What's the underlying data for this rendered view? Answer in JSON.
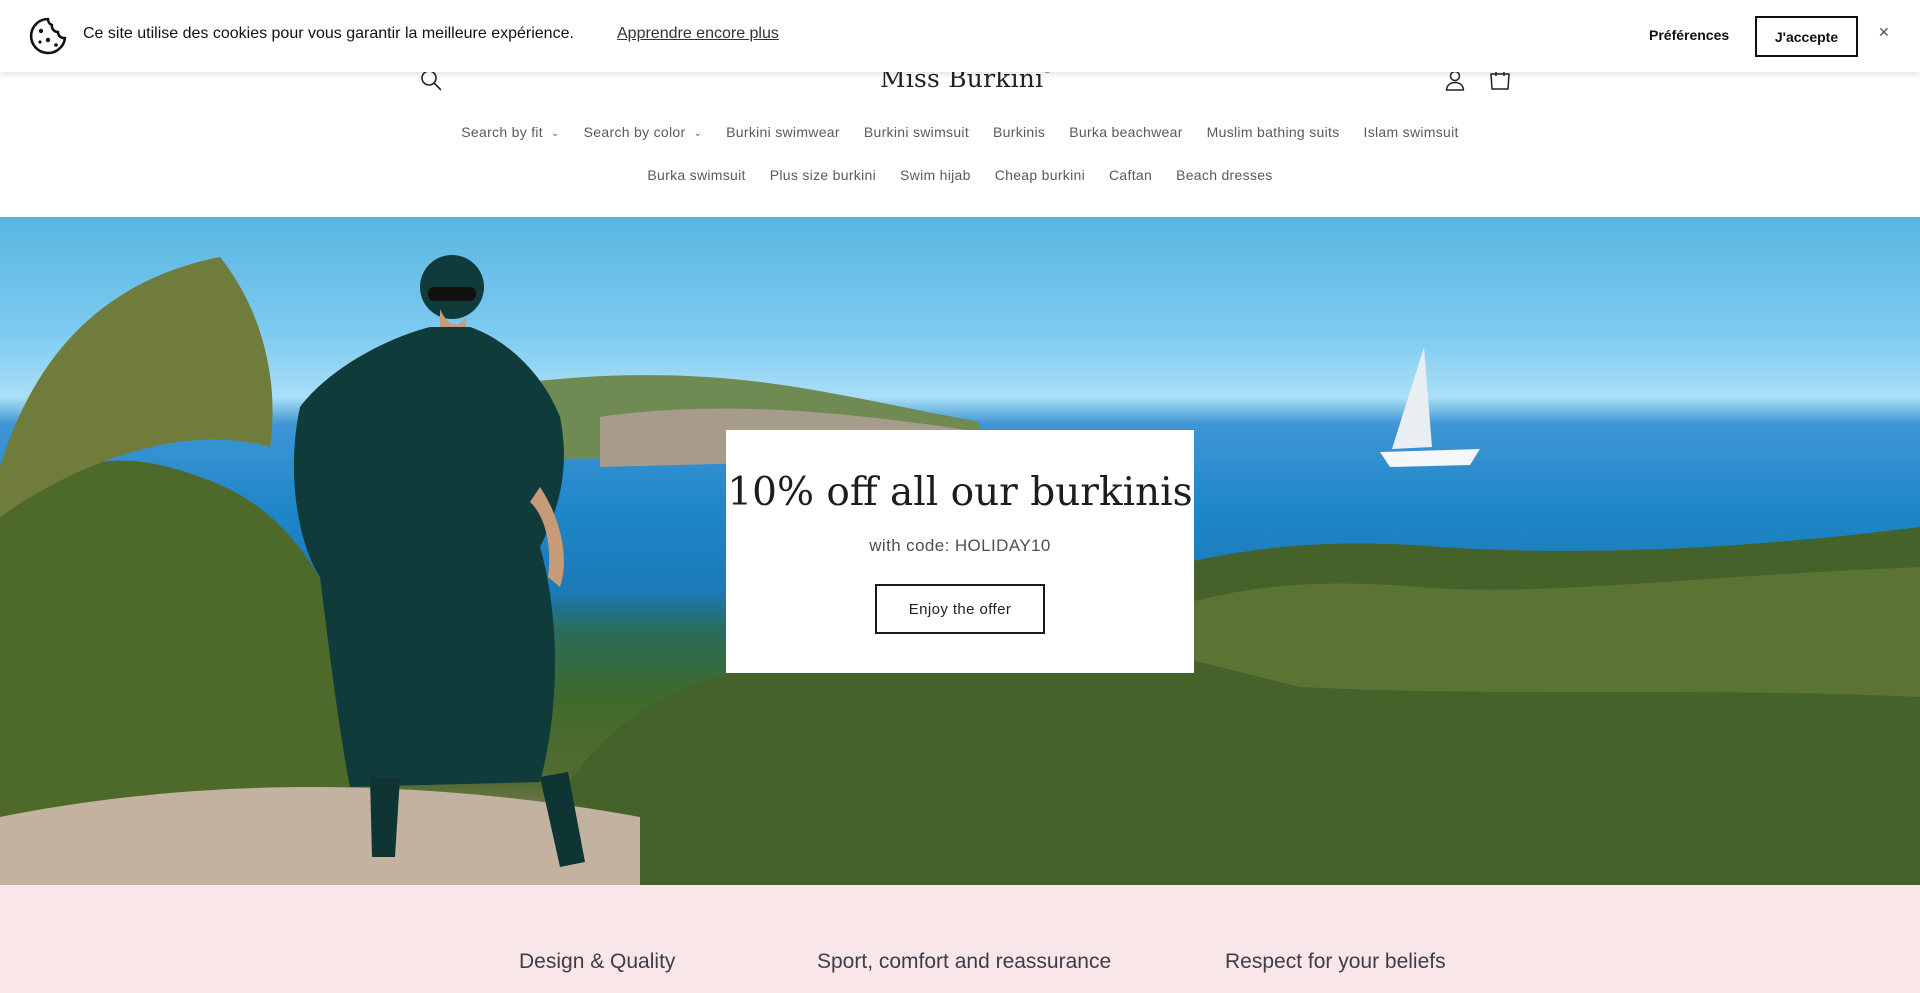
{
  "cookie_banner": {
    "icon": "cookie-icon",
    "message": "Ce site utilise des cookies pour vous garantir la meilleure expérience.",
    "learn_more": "Apprendre encore plus",
    "preferences": "Préférences",
    "accept": "J'accepte",
    "close": "✕"
  },
  "header": {
    "logo": "Miss Burkini",
    "logo_mark": "©",
    "icons": [
      "search-icon",
      "account-icon",
      "cart-icon"
    ]
  },
  "nav": {
    "row1": [
      {
        "label": "Search by fit",
        "dropdown": true
      },
      {
        "label": "Search by color",
        "dropdown": true
      },
      {
        "label": "Burkini swimwear"
      },
      {
        "label": "Burkini swimsuit"
      },
      {
        "label": "Burkinis"
      },
      {
        "label": "Burka beachwear"
      },
      {
        "label": "Muslim bathing suits"
      },
      {
        "label": "Islam swimsuit"
      }
    ],
    "row2": [
      {
        "label": "Burka swimsuit"
      },
      {
        "label": "Plus size burkini"
      },
      {
        "label": "Swim hijab"
      },
      {
        "label": "Cheap burkini"
      },
      {
        "label": "Caftan"
      },
      {
        "label": "Beach dresses"
      }
    ],
    "chevron": "⌄"
  },
  "hero": {
    "title": "10% off all our burkinis",
    "subtitle": "with code: HOLIDAY10",
    "button": "Enjoy the offer"
  },
  "features": [
    {
      "label": "Design & Quality"
    },
    {
      "label": "Sport, comfort and reassurance"
    },
    {
      "label": "Respect for your beliefs"
    }
  ],
  "colors": {
    "features_bg": "#f8e6e8",
    "sea": "#1e86c9",
    "outfit": "#0f3b3a"
  }
}
